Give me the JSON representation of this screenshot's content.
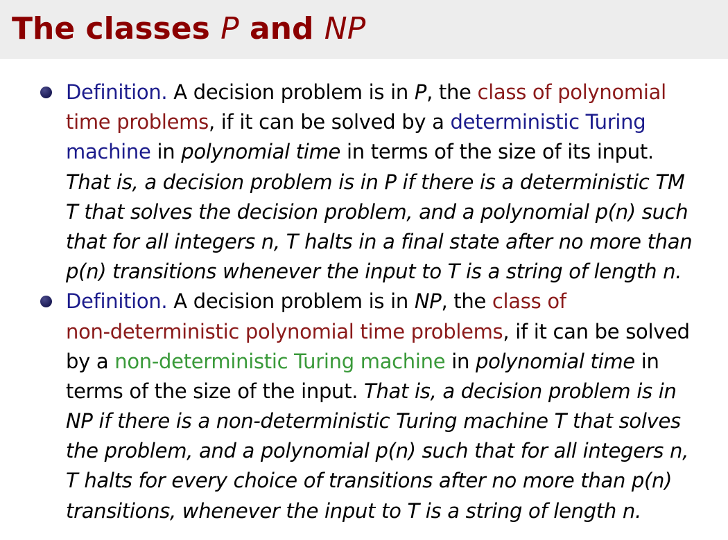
{
  "slide": {
    "title_prefix": "The classes ",
    "title_p": "P",
    "title_and": " and ",
    "title_np": "NP"
  },
  "definitions": [
    {
      "label": "Definition.",
      "lines": [
        [
          {
            "t": " A decision problem is in ",
            "s": ""
          },
          {
            "t": "P",
            "s": "em"
          },
          {
            "t": ", the ",
            "s": ""
          },
          {
            "t": "class of polynomial",
            "s": "red"
          }
        ],
        [
          {
            "t": "time problems",
            "s": "red"
          },
          {
            "t": ", if it can be solved by a ",
            "s": ""
          },
          {
            "t": "deterministic Turing",
            "s": "blue"
          }
        ],
        [
          {
            "t": "machine",
            "s": "blue"
          },
          {
            "t": " in ",
            "s": ""
          },
          {
            "t": "polynomial time",
            "s": "em"
          },
          {
            "t": " in terms of the size of its input.",
            "s": ""
          }
        ],
        [
          {
            "t": "That is, a decision problem is in P if there is a deterministic TM",
            "s": "em"
          }
        ],
        [
          {
            "t": "T that solves the decision problem, and a polynomial p(n) such",
            "s": "em"
          }
        ],
        [
          {
            "t": "that for all integers n, T halts in a final state after no more than",
            "s": "em"
          }
        ],
        [
          {
            "t": "p(n) transitions whenever the input to T is a string of length n.",
            "s": "em"
          }
        ]
      ]
    },
    {
      "label": "Definition.",
      "lines": [
        [
          {
            "t": " A decision problem is in ",
            "s": ""
          },
          {
            "t": "NP",
            "s": "em"
          },
          {
            "t": ", the ",
            "s": ""
          },
          {
            "t": "class of",
            "s": "red"
          }
        ],
        [
          {
            "t": "non-deterministic polynomial time problems",
            "s": "red"
          },
          {
            "t": ", if it can be solved",
            "s": ""
          }
        ],
        [
          {
            "t": "by a ",
            "s": ""
          },
          {
            "t": "non-deterministic Turing machine",
            "s": "green"
          },
          {
            "t": " in ",
            "s": ""
          },
          {
            "t": "polynomial time",
            "s": "em"
          },
          {
            "t": " in",
            "s": ""
          }
        ],
        [
          {
            "t": "terms of the size of the input. ",
            "s": ""
          },
          {
            "t": "That is, a decision problem is in",
            "s": "em"
          }
        ],
        [
          {
            "t": "NP if there is a non-deterministic Turing machine T that solves",
            "s": "em"
          }
        ],
        [
          {
            "t": "the problem, and a polynomial p(n) such that for all integers n,",
            "s": "em"
          }
        ],
        [
          {
            "t": "T halts for every choice of transitions after no more than p(n)",
            "s": "em"
          }
        ],
        [
          {
            "t": "transitions, whenever the input to T is a string of length n.",
            "s": "em"
          }
        ]
      ]
    }
  ]
}
